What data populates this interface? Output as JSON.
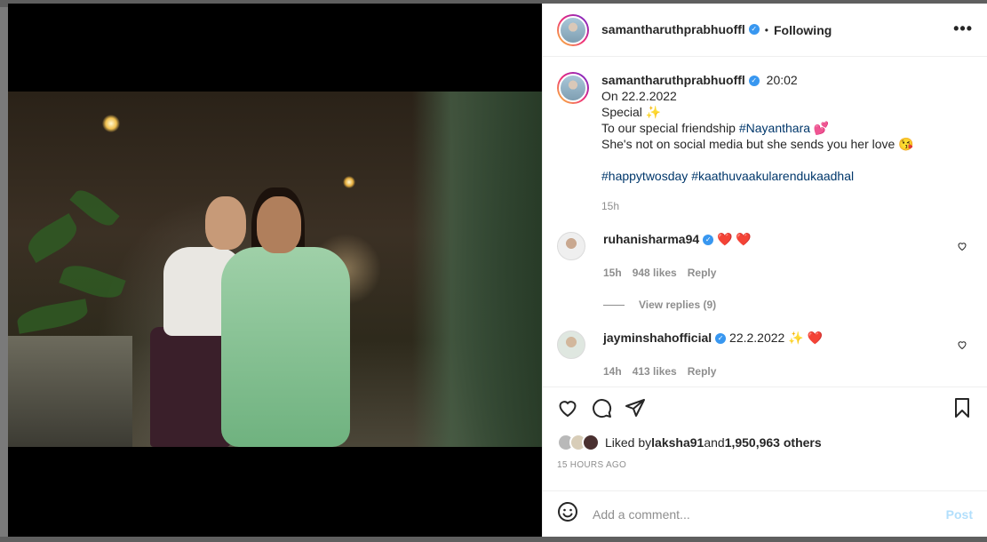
{
  "post": {
    "author": "samantharuthprabhuoffl",
    "follow_state": "Following",
    "more_label": "•••"
  },
  "caption": {
    "author": "samantharuthprabhuoffl",
    "time_inline": "20:02",
    "lines": [
      "On 22.2.2022",
      "Special ✨"
    ],
    "line3_text": "To our special friendship ",
    "line3_tag": "#Nayanthara",
    "line3_emoji": " 💕",
    "line4": "She's not on social media but she sends you her love 😘",
    "hashtags": [
      "#happytwosday",
      "#kaathuvaakularendukaadhal"
    ],
    "age": "15h"
  },
  "comments": [
    {
      "user": "ruhanisharma94",
      "text": "❤️ ❤️",
      "age": "15h",
      "likes": "948 likes",
      "reply_label": "Reply",
      "view_replies": "View replies (9)"
    },
    {
      "user": "jayminshahofficial",
      "text": "22.2.2022 ✨ ❤️",
      "age": "14h",
      "likes": "413 likes",
      "reply_label": "Reply"
    }
  ],
  "likes_line": {
    "prefix": "Liked by ",
    "user": "laksha91",
    "middle": " and ",
    "count": "1,950,963 others"
  },
  "posted_ago": "15 HOURS AGO",
  "composer": {
    "placeholder": "Add a comment...",
    "post_label": "Post"
  },
  "colors": {
    "verified": "#3897f0",
    "hashtag": "#00376b",
    "post_disabled": "#b2dffc"
  },
  "icons": [
    "heart-icon",
    "comment-icon",
    "share-icon",
    "bookmark-icon",
    "emoji-icon",
    "verified-icon",
    "more-icon"
  ]
}
